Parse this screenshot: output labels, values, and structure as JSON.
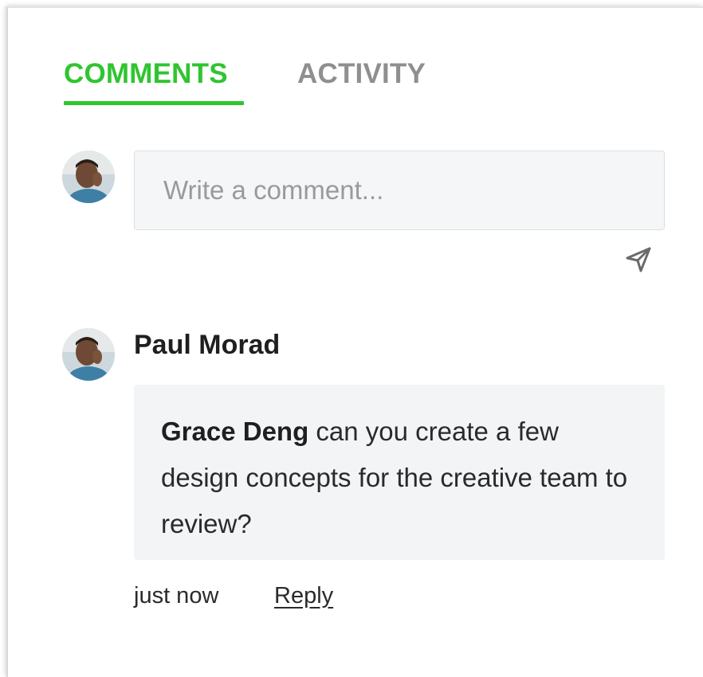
{
  "tabs": [
    {
      "label": "COMMENTS",
      "active": true
    },
    {
      "label": "ACTIVITY",
      "active": false
    }
  ],
  "composer": {
    "placeholder": "Write a comment...",
    "send_icon": "send-paper-plane-icon"
  },
  "comment": {
    "author": "Paul Morad",
    "mention": "Grace Deng",
    "text": " can you create a few design concepts for the creative team to review?",
    "timestamp": "just now",
    "reply_label": "Reply"
  },
  "colors": {
    "accent": "#2fc52f",
    "inactive_tab": "#8f8f8f",
    "input_bg": "#f5f6f8",
    "bubble_bg": "#f3f4f6"
  }
}
